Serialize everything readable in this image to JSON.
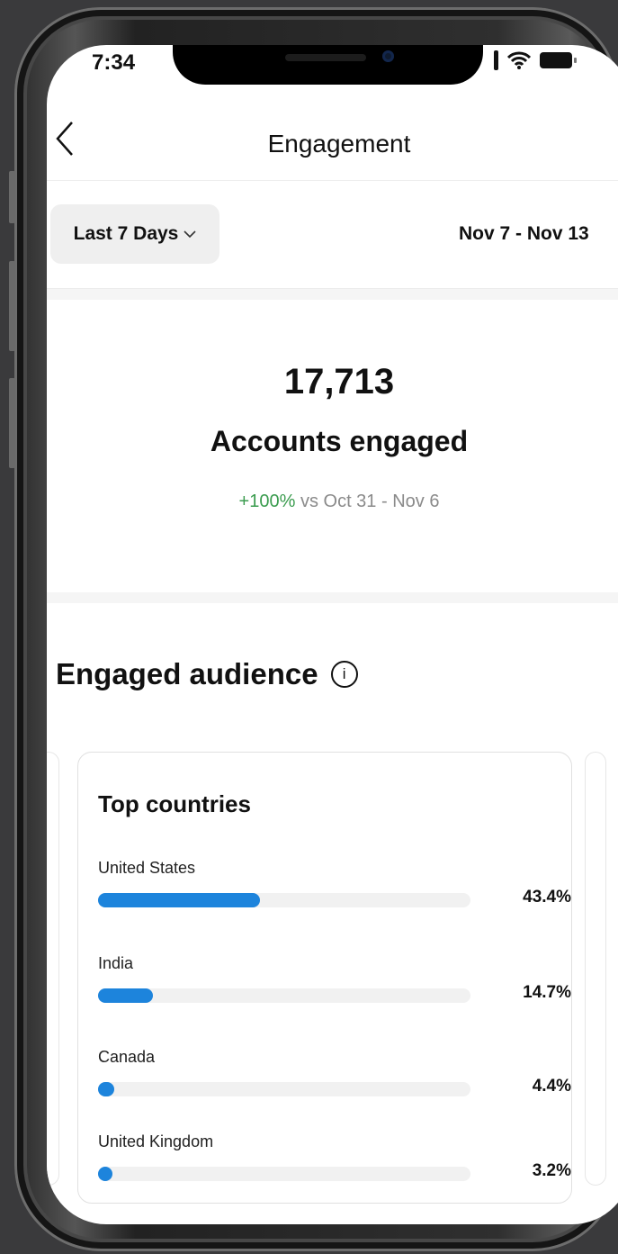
{
  "status_bar": {
    "time": "7:34"
  },
  "nav": {
    "back_icon": "chevron-left-icon",
    "title": "Engagement"
  },
  "filter": {
    "period": "Last 7 Days",
    "date_range": "Nov 7 - Nov 13"
  },
  "summary": {
    "value": "17,713",
    "label": "Accounts engaged",
    "change": "+100%",
    "comparison": "vs Oct 31 - Nov 6"
  },
  "audience": {
    "title": "Engaged audience",
    "card_title": "Top countries",
    "countries": [
      {
        "name": "United States",
        "percent_label": "43.4%",
        "share": 43.4
      },
      {
        "name": "India",
        "percent_label": "14.7%",
        "share": 14.7
      },
      {
        "name": "Canada",
        "percent_label": "4.4%",
        "share": 4.4
      },
      {
        "name": "United Kingdom",
        "percent_label": "3.2%",
        "share": 3.2
      }
    ]
  },
  "colors": {
    "accent": "#1d84dc",
    "positive": "#3b9c4f"
  }
}
